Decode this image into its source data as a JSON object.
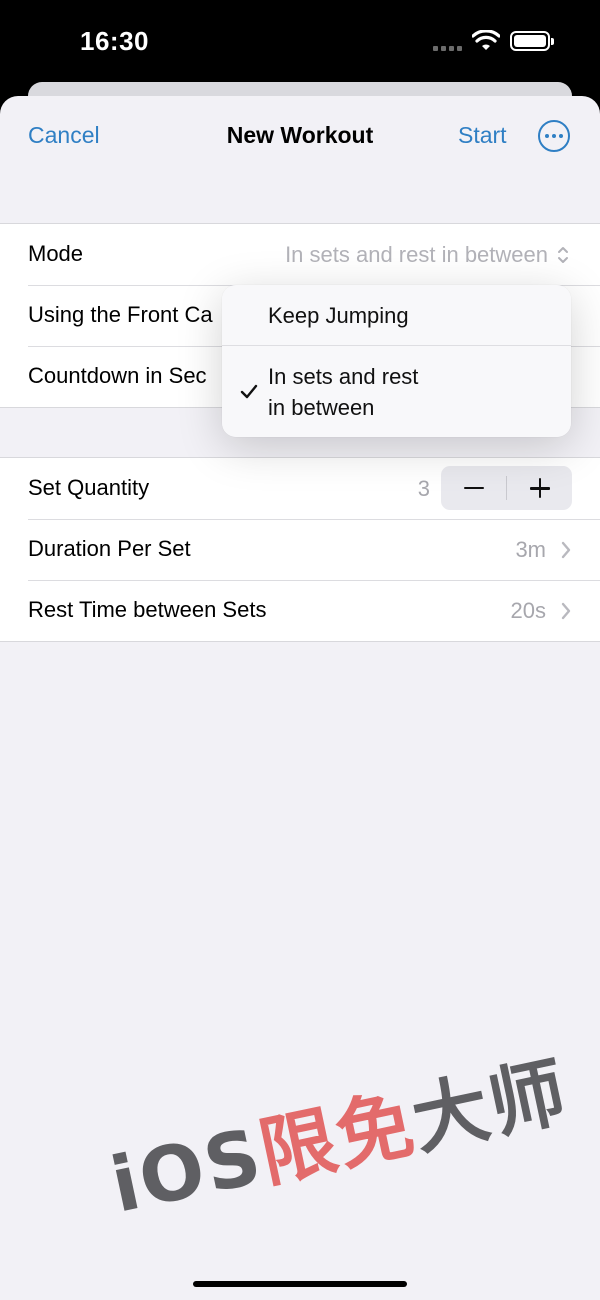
{
  "status_bar": {
    "time": "16:30"
  },
  "nav": {
    "cancel": "Cancel",
    "title": "New Workout",
    "start": "Start",
    "more_icon": "ellipsis-circle-icon",
    "accent": "#2f7fc4"
  },
  "settings": {
    "mode_label": "Mode",
    "mode_value": "In sets and rest in between",
    "front_camera_label": "Using the Front Ca",
    "countdown_label": "Countdown in Sec"
  },
  "popup": {
    "options": [
      "Keep Jumping",
      "In sets and rest\nin between"
    ],
    "selected_index": 1
  },
  "sets": {
    "quantity_label": "Set Quantity",
    "quantity_value": "3",
    "duration_label": "Duration Per Set",
    "duration_value": "3m",
    "rest_label": "Rest Time between Sets",
    "rest_value": "20s"
  },
  "watermark": {
    "part1": "iOS",
    "part2": "限免",
    "part3": "大师"
  }
}
